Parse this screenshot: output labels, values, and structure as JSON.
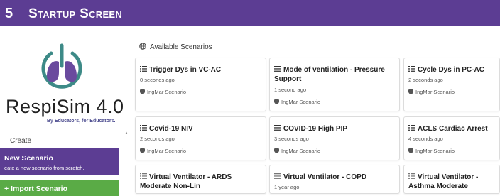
{
  "header": {
    "number": "5",
    "title": "Startup Screen"
  },
  "logo": {
    "text": "RespiSim 4.0",
    "tagline": "By Educators, for Educators."
  },
  "sidebar": {
    "create_label": "Create",
    "new_scenario": {
      "title": "New Scenario",
      "subtitle": "eate a new scenario from scratch."
    },
    "import_scenario": {
      "title": "Import Scenario"
    }
  },
  "main": {
    "section_title": "Available Scenarios",
    "cards": [
      {
        "title": "Trigger Dys in VC-AC",
        "time": "0 seconds ago",
        "source": "IngMar Scenario"
      },
      {
        "title": "Mode of ventilation - Pressure Support",
        "time": "1 second ago",
        "source": "IngMar Scenario"
      },
      {
        "title": "Cycle Dys in PC-AC",
        "time": "2 seconds ago",
        "source": "IngMar Scenario"
      },
      {
        "title": "Covid-19 NIV",
        "time": "2 seconds ago",
        "source": "IngMar Scenario"
      },
      {
        "title": "COVID-19 High PIP",
        "time": "3 seconds ago",
        "source": "IngMar Scenario"
      },
      {
        "title": "ACLS Cardiac Arrest",
        "time": "4 seconds ago",
        "source": "IngMar Scenario"
      },
      {
        "title": "Virtual Ventilator - ARDS Moderate Non-Lin",
        "time": "",
        "source": ""
      },
      {
        "title": "Virtual Ventilator - COPD",
        "time": "1 year ago",
        "source": ""
      },
      {
        "title": "Virtual Ventilator - Asthma Moderate",
        "time": "",
        "source": ""
      }
    ]
  },
  "colors": {
    "header": "#5c3d93",
    "new_button": "#5c3d93",
    "import_button": "#5aab46",
    "logo_teal": "#3d8a87"
  }
}
